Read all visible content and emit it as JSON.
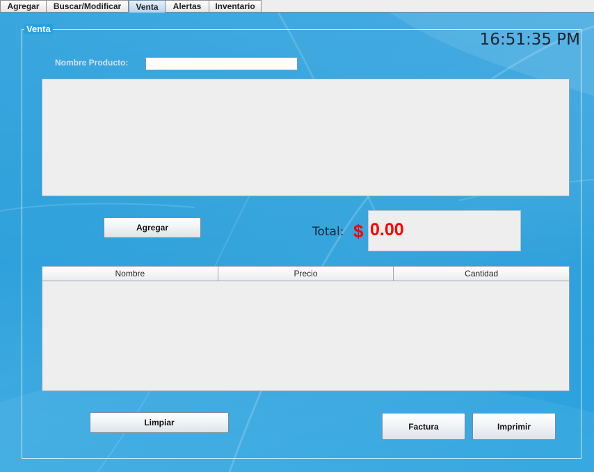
{
  "tabs": [
    {
      "label": "Agregar"
    },
    {
      "label": "Buscar/Modificar"
    },
    {
      "label": "Venta"
    },
    {
      "label": "Alertas"
    },
    {
      "label": "Inventario"
    }
  ],
  "active_tab": "Venta",
  "venta": {
    "group_title": "Venta",
    "clock": "16:51:35 PM",
    "product_label": "Nombre Producto:",
    "product_value": "",
    "add_button": "Agregar",
    "total_label": "Total:",
    "currency_symbol": "$",
    "total_value": "0.00",
    "table": {
      "columns": [
        "Nombre",
        "Precio",
        "Cantidad"
      ],
      "rows": []
    },
    "clear_button": "Limpiar",
    "invoice_button": "Factura",
    "print_button": "Imprimir"
  },
  "colors": {
    "background": "#2aa1dc",
    "total_text": "#ff0000",
    "panel": "#eeeeee"
  }
}
